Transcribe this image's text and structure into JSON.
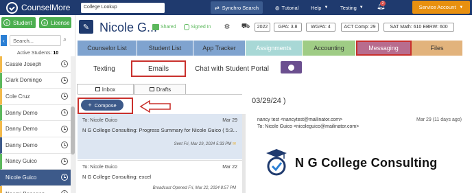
{
  "topbar": {
    "brand": "CounselMore",
    "lookup_placeholder": "College Lookup",
    "synchro": "Synchro Search",
    "tutorial": "Tutorial",
    "help": "Help",
    "testing": "Testing",
    "notif_count": "2",
    "service": "Service Account"
  },
  "left": {
    "add_student": "Student",
    "add_license": "License",
    "search_placeholder": "Search...",
    "active_label": "Active Students:",
    "active_count": "10",
    "students": [
      "Cassie Joseph",
      "Clark Domingo",
      "Cole Cruz",
      "Danny Demo",
      "Danny Demo",
      "Danny Demo",
      "Nancy Guico",
      "Nicole Guico",
      "Noemi Banagan"
    ],
    "selected_index": 7,
    "accent_colors": [
      "#f2b94b",
      "#5cb85c",
      "#f2b94b",
      "#5cb85c",
      "#f2b94b",
      "#3d5a8a",
      "#5cb85c",
      "#3d5a8a",
      "#f2b94b"
    ]
  },
  "header": {
    "name": "Nicole G...",
    "shared": "Shared",
    "signed_in": "Signed In",
    "year": "2022",
    "gpa": "GPA: 3.8",
    "wgpa": "WGPA: 4",
    "act": "ACT Comp: 29",
    "sat": "SAT   Math: 610   EBRW: 600"
  },
  "tabs": [
    {
      "label": "Counselor List",
      "color": "#7fa3cf"
    },
    {
      "label": "Student List",
      "color": "#7fa3cf"
    },
    {
      "label": "App Tracker",
      "color": "#7fa3cf"
    },
    {
      "label": "Assignments",
      "color": "#a8d8d6"
    },
    {
      "label": "Accounting",
      "color": "#9fcc85"
    },
    {
      "label": "Messaging",
      "color": "#b86c8e"
    },
    {
      "label": "Files",
      "color": "#e2b37c"
    }
  ],
  "subtabs": {
    "texting": "Texting",
    "emails": "Emails",
    "chat": "Chat with Student Portal"
  },
  "mailtabs": {
    "inbox": "Inbox",
    "drafts": "Drafts"
  },
  "compose": "Compose",
  "mails": [
    {
      "to": "To: Nicole Guico",
      "date": "Mar 29",
      "subject": "N G College Consulting: Progress Summary for Nicole Guico ( 5:3...",
      "sent": "Sent Fri, Mar 29, 2024 5:33 PM"
    },
    {
      "to": "To: Nicole Guico",
      "date": "Mar 22",
      "subject": "N G College Consulting: excel",
      "sent": "Broadcast  Opened Fri, Mar 22, 2024 8:57 PM"
    }
  ],
  "preview": {
    "date": "03/29/24 )",
    "from": "nancy test <nancytest@mailinator.com>",
    "to": "To: Nicole Guico <nicoleguico@mailinator.com>",
    "when": "Mar 29 (11 days ago)",
    "logo_text": "N G College Consulting"
  }
}
